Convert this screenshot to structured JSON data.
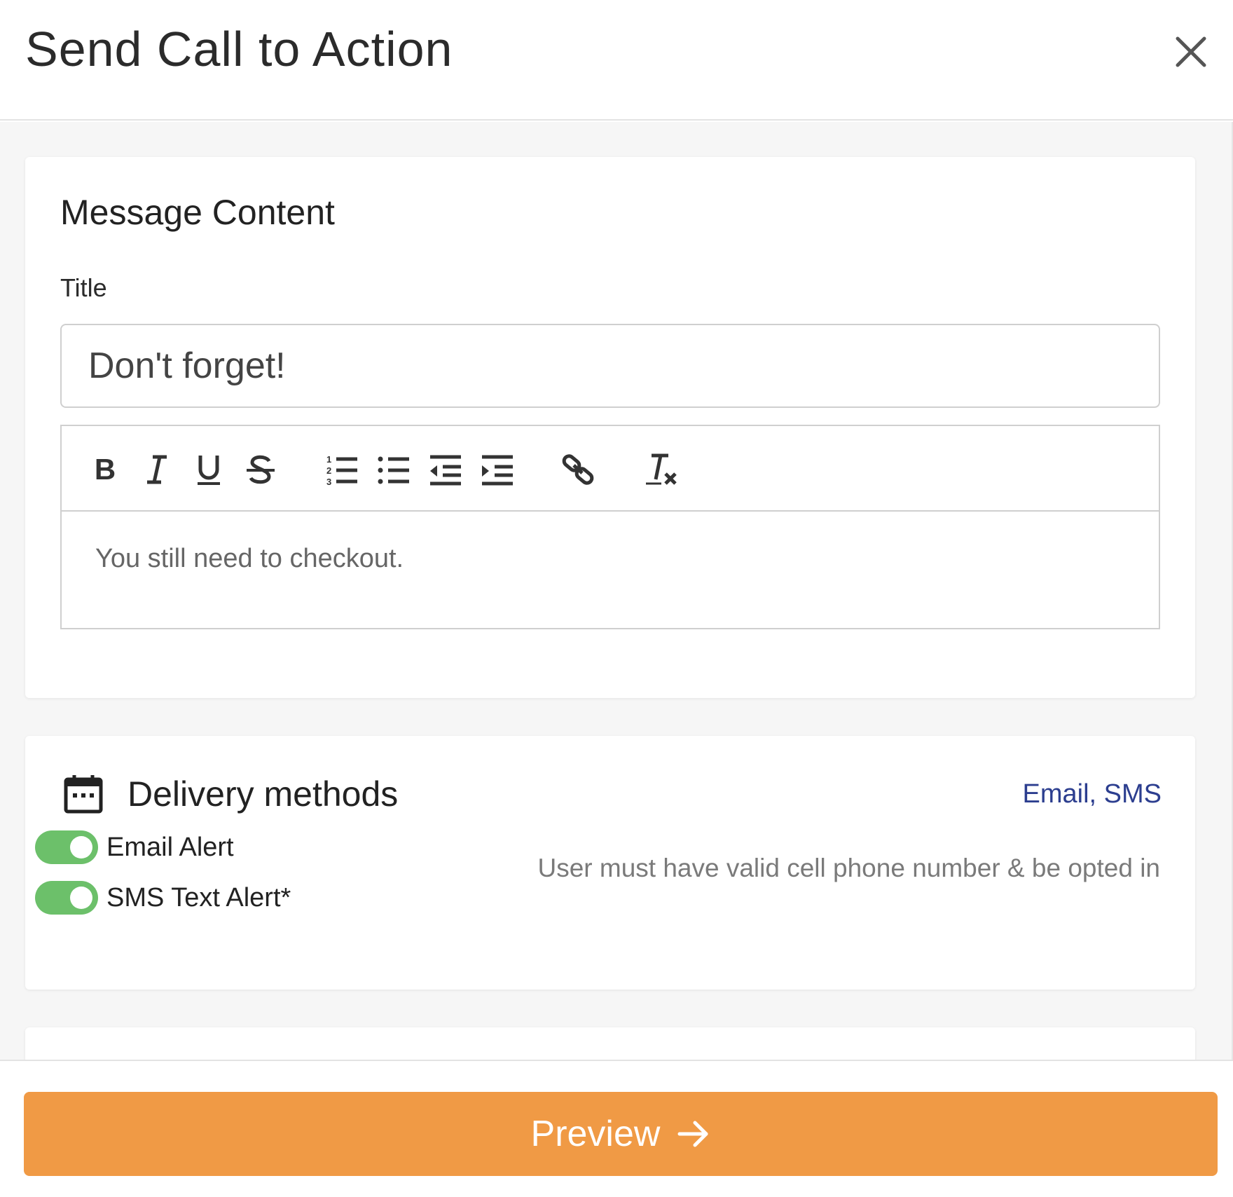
{
  "modal": {
    "title": "Send Call to Action",
    "close_icon": "close-icon"
  },
  "message_content": {
    "heading": "Message Content",
    "title_label": "Title",
    "title_value": "Don't forget!",
    "toolbar": [
      "bold-icon",
      "italic-icon",
      "underline-icon",
      "strikethrough-icon",
      "ordered-list-icon",
      "bullet-list-icon",
      "outdent-icon",
      "indent-icon",
      "link-icon",
      "clear-format-icon"
    ],
    "body_text": "You still need to checkout."
  },
  "delivery": {
    "heading": "Delivery methods",
    "summary": "Email, SMS",
    "icon": "calendar-icon",
    "options": [
      {
        "label": "Email Alert",
        "enabled": true
      },
      {
        "label": "SMS Text Alert*",
        "enabled": true,
        "note": "User must have valid cell phone number & be opted in"
      }
    ]
  },
  "footer": {
    "preview_label": "Preview"
  },
  "colors": {
    "accent": "#f09a45",
    "toggle_on": "#6cc06a",
    "link": "#2c3e8f"
  }
}
